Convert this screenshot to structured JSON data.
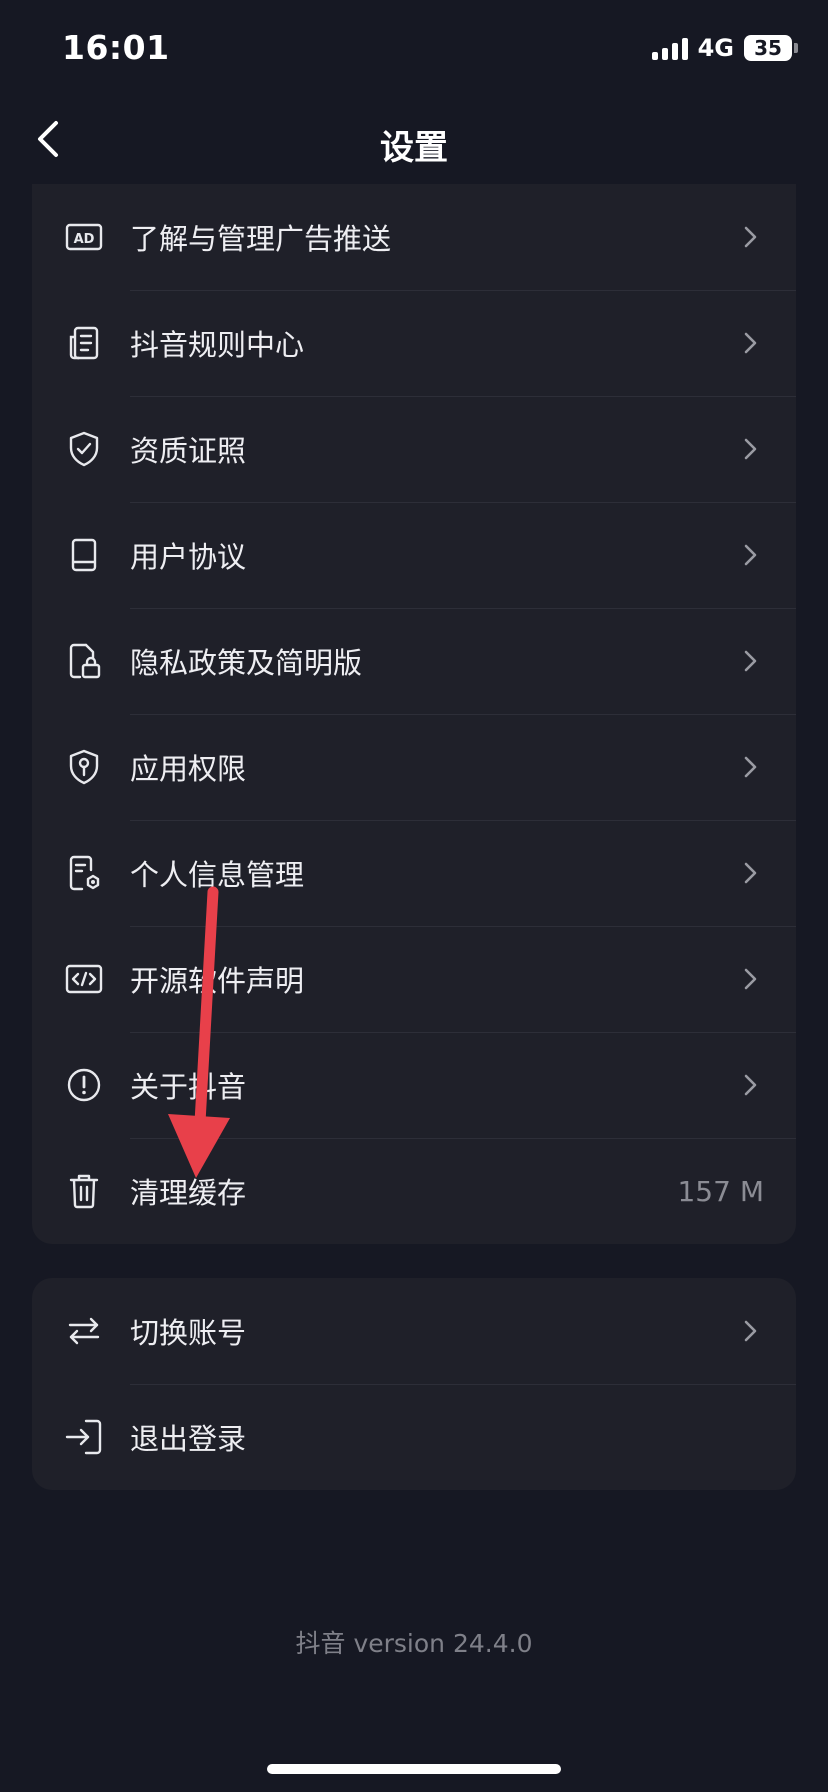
{
  "status_bar": {
    "time": "16:01",
    "network": "4G",
    "battery": "35"
  },
  "nav": {
    "title": "设置",
    "back_icon": "chevron-left-icon"
  },
  "settings": {
    "items": [
      {
        "label": "了解与管理广告推送",
        "icon": "ad-icon"
      },
      {
        "label": "抖音规则中心",
        "icon": "document-list-icon"
      },
      {
        "label": "资质证照",
        "icon": "shield-check-icon"
      },
      {
        "label": "用户协议",
        "icon": "book-icon"
      },
      {
        "label": "隐私政策及简明版",
        "icon": "file-lock-icon"
      },
      {
        "label": "应用权限",
        "icon": "shield-key-icon"
      },
      {
        "label": "个人信息管理",
        "icon": "file-gear-icon"
      },
      {
        "label": "开源软件声明",
        "icon": "code-icon"
      },
      {
        "label": "关于抖音",
        "icon": "info-circle-icon"
      },
      {
        "label": "清理缓存",
        "icon": "trash-icon",
        "value": "157 M"
      }
    ]
  },
  "account": {
    "items": [
      {
        "label": "切换账号",
        "icon": "swap-icon"
      },
      {
        "label": "退出登录",
        "icon": "logout-icon"
      }
    ]
  },
  "version": "抖音 version 24.4.0",
  "colors": {
    "background": "#161823",
    "card": "#1f2029",
    "annotation_arrow": "#e8404a"
  }
}
